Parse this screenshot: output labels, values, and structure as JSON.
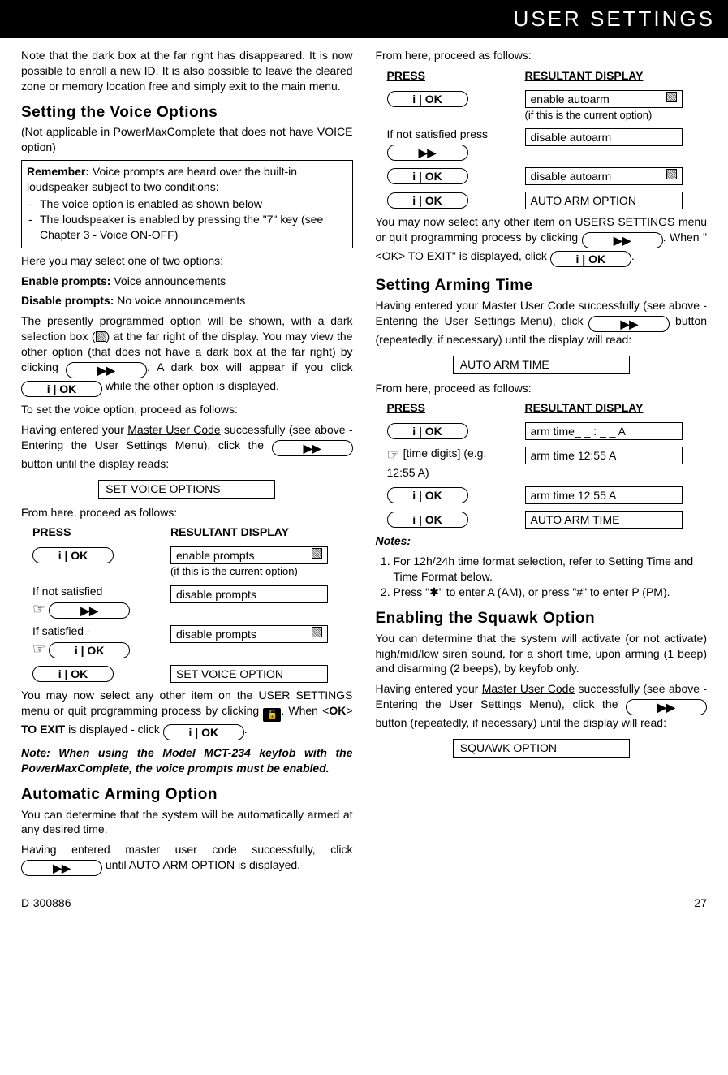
{
  "header": {
    "title": "USER SETTINGS"
  },
  "left": {
    "intro": "Note that the dark box at the far right has disappeared. It is now possible to enroll a new ID. It is also possible to leave the cleared zone or memory location free and simply exit to the main menu.",
    "voice": {
      "heading": "Setting the Voice Options",
      "sub": "(Not applicable in PowerMaxComplete that does not have VOICE option)",
      "remember_label": "Remember:",
      "remember_text": " Voice prompts are heard over the built-in loudspeaker subject to two conditions:",
      "bullets": [
        "The voice option is enabled as shown below",
        "The loudspeaker is enabled by pressing the \"7\" key (see Chapter 3 - Voice ON-OFF)"
      ],
      "here": "Here you may select one of two options:",
      "enable_label": "Enable prompts:",
      "enable_text": " Voice announcements",
      "disable_label": "Disable prompts:",
      "disable_text": " No voice announcements",
      "presently1": "The presently programmed option will be shown, with a dark selection box (",
      "presently2": ") at the far right of the display. You may view the other option (that does not have a dark box at the far right) by clicking ",
      "presently3": ". A dark box will appear if you click ",
      "presently4": " while the other option is displayed.",
      "toset": "To set the voice option, proceed as follows:",
      "having1": "Having entered your ",
      "master": "Master User Code",
      "having2": " successfully (see above - Entering the User Settings Menu), click the ",
      "having3": " button until the display reads:",
      "display_initial": "SET VOICE OPTIONS",
      "fromhere": "From here, proceed as follows:",
      "press": "PRESS",
      "result": "RESULTANT DISPLAY",
      "seq": [
        {
          "left_btn": "i | OK",
          "right_disp": "enable prompts",
          "right_has_box": true,
          "right_note": "(if this is the current option)"
        },
        {
          "left_label": "If not satisfied",
          "left_hand": true,
          "left_btn": "▶▶",
          "right_disp": "disable prompts"
        },
        {
          "left_label": "If satisfied -",
          "left_hand": true,
          "left_btn": "i | OK",
          "right_disp": "disable prompts",
          "right_has_box": true
        },
        {
          "left_btn": "i | OK",
          "right_disp": "SET VOICE OPTION"
        }
      ],
      "after1": "You may now select any other item on the USER SETTINGS menu or quit programming process by clicking ",
      "after2": ". When <",
      "after_ok": "OK",
      "after3": "> ",
      "after_toexit": "TO EXIT",
      "after4": " is displayed - click ",
      "after5": ".",
      "note_model": "Note: When using the Model MCT-234 keyfob with the PowerMaxComplete, the voice prompts must be enabled."
    },
    "autoarm": {
      "heading": "Automatic Arming Option",
      "p1": "You can determine that the system will be automatically armed at any desired time.",
      "p2a": "Having entered master user code successfully, click ",
      "p2b": " until AUTO ARM OPTION is displayed."
    }
  },
  "right": {
    "fromhere": "From here, proceed as follows:",
    "press": "PRESS",
    "result": "RESULTANT DISPLAY",
    "seq1": [
      {
        "left_btn": "i | OK",
        "right_disp": "enable autoarm",
        "right_has_box": true,
        "right_note": "(if this is the current option)"
      },
      {
        "left_label": "If not satisfied press",
        "left_btn": "▶▶",
        "right_disp": "disable autoarm"
      },
      {
        "left_btn": "i | OK",
        "right_disp": "disable autoarm",
        "right_has_box": true
      },
      {
        "left_btn": "i | OK",
        "right_disp": "AUTO ARM OPTION"
      }
    ],
    "after1": "You may now select any other item on USERS SETTINGS menu or quit programming process by clicking ",
    "after2": ". When \"<OK> TO EXIT\" is displayed, click ",
    "after3": ".",
    "armtime": {
      "heading": "Setting Arming Time",
      "p1a": "Having entered your Master User Code successfully (see above - Entering the User Settings Menu), click ",
      "p1b": " button (repeatedly, if necessary) until the display will read:",
      "display_initial": "AUTO ARM TIME",
      "fromhere": "From here, proceed as follows:",
      "seq": [
        {
          "left_btn": "i | OK",
          "right_disp": "arm time_ _ : _ _ A"
        },
        {
          "left_hand": true,
          "left_label": "[time digits] (e.g. 12:55 A)",
          "right_disp": "arm time 12:55 A"
        },
        {
          "left_btn": "i | OK",
          "right_disp": "arm time 12:55 A"
        },
        {
          "left_btn": "i | OK",
          "right_disp": "AUTO ARM TIME"
        }
      ],
      "notes_label": "Notes:",
      "notes": [
        "For 12h/24h time format selection, refer to Setting Time and Time Format  below.",
        "Press \"✱\" to enter A (AM), or press \"#\" to enter P (PM)."
      ]
    },
    "squawk": {
      "heading": "Enabling the Squawk Option",
      "p1": "You can determine that the system will activate (or not activate) high/mid/low siren sound, for a short time, upon arming (1 beep) and disarming (2 beeps), by keyfob only.",
      "p2a": "Having entered your ",
      "master": "Master User Code",
      "p2b": " successfully (see above - Entering the User Settings Menu), click the ",
      "p2c": " button (repeatedly, if necessary) until the display will read:",
      "display_initial": "SQUAWK OPTION"
    }
  },
  "buttons": {
    "ok": "i | OK",
    "fwd": "▶▶"
  },
  "footer": {
    "doc": "D-300886",
    "page": "27"
  }
}
